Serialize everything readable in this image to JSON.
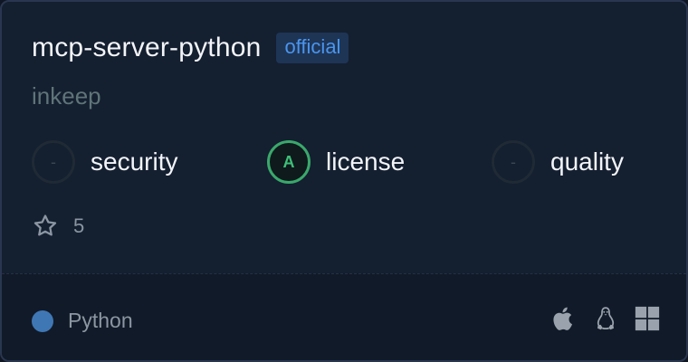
{
  "card": {
    "title": "mcp-server-python",
    "badge": "official",
    "author": "inkeep"
  },
  "scores": [
    {
      "grade": "-",
      "label": "security"
    },
    {
      "grade": "A",
      "label": "license"
    },
    {
      "grade": "-",
      "label": "quality"
    }
  ],
  "stars": {
    "icon": "star-outline-icon",
    "count": "5"
  },
  "footer": {
    "language": "Python",
    "language_color": "#3f77b4",
    "platforms": [
      "apple-icon",
      "linux-icon",
      "windows-icon"
    ]
  },
  "colors": {
    "grade_a": "#3fbf78",
    "badge_text": "#4a95ee"
  }
}
